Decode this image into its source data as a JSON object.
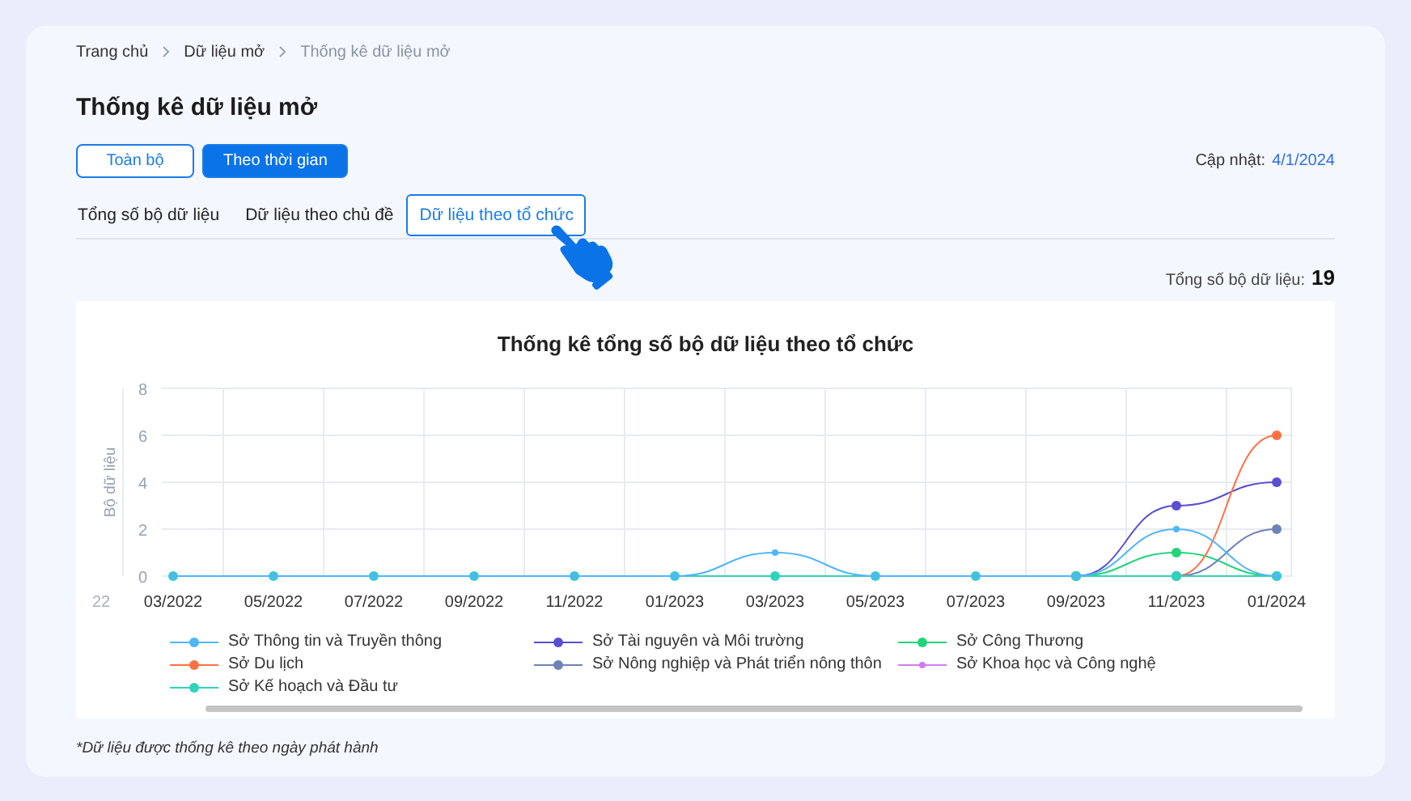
{
  "breadcrumb": [
    {
      "label": "Trang chủ",
      "current": false
    },
    {
      "label": "Dữ liệu mở",
      "current": false
    },
    {
      "label": "Thống kê dữ liệu mở",
      "current": true
    }
  ],
  "title": "Thống kê dữ liệu mở",
  "view_buttons": [
    {
      "label": "Toàn bộ",
      "selected": false
    },
    {
      "label": "Theo thời gian",
      "selected": true
    }
  ],
  "updated": {
    "label": "Cập nhật:",
    "value": "4/1/2024"
  },
  "tabs": [
    {
      "label": "Tổng số bộ dữ liệu",
      "selected": false
    },
    {
      "label": "Dữ liệu theo chủ đề",
      "selected": false
    },
    {
      "label": "Dữ liệu theo tổ chức",
      "selected": true
    }
  ],
  "total": {
    "label": "Tổng số bộ dữ liệu:",
    "value": "19"
  },
  "chart": {
    "clipped_label": "22",
    "chart_data": {
      "type": "line",
      "title": "Thống kê tổng số bộ dữ liệu theo tổ chức",
      "ylabel": "Bộ dữ liệu",
      "grid": true,
      "legend": "bottom",
      "categories": [
        "03/2022",
        "05/2022",
        "07/2022",
        "09/2022",
        "11/2022",
        "01/2023",
        "03/2023",
        "05/2023",
        "07/2023",
        "09/2023",
        "11/2023",
        "01/2024"
      ],
      "ylim": [
        0,
        8
      ],
      "yticks": [
        0,
        2,
        4,
        6,
        8
      ],
      "series": [
        {
          "name": "Sở Thông tin và Truyền thông",
          "color": "#4fb6f7",
          "marker": true,
          "values": [
            0,
            0,
            0,
            0,
            0,
            0,
            1,
            0,
            0,
            0,
            2,
            0
          ]
        },
        {
          "name": "Sở Tài nguyên và Môi trường",
          "color": "#5a4fcf",
          "marker": true,
          "values": [
            null,
            null,
            null,
            null,
            null,
            null,
            null,
            null,
            null,
            0,
            3,
            4
          ]
        },
        {
          "name": "Sở Công Thương",
          "color": "#22d47a",
          "marker": true,
          "values": [
            null,
            null,
            null,
            null,
            null,
            null,
            null,
            null,
            null,
            0,
            1,
            0
          ]
        },
        {
          "name": "Sở Du lịch",
          "color": "#ff7043",
          "marker": true,
          "values": [
            null,
            null,
            null,
            null,
            null,
            null,
            null,
            null,
            null,
            null,
            0,
            6
          ]
        },
        {
          "name": "Sở Nông nghiệp và Phát triển nông thôn",
          "color": "#6f82b8",
          "marker": true,
          "values": [
            null,
            null,
            null,
            null,
            null,
            null,
            null,
            null,
            null,
            null,
            0,
            2
          ]
        },
        {
          "name": "Sở Khoa học và Công nghệ",
          "color": "#d07cf0",
          "values": [
            null,
            null,
            null,
            null,
            null,
            null,
            null,
            null,
            null,
            null,
            null,
            null
          ]
        },
        {
          "name": "Sở Kế hoạch và Đầu tư",
          "color": "#2ed3be",
          "marker": true,
          "values": [
            0,
            0,
            0,
            0,
            0,
            0,
            0,
            0,
            0,
            0,
            0,
            0
          ]
        }
      ]
    }
  },
  "footnote": "*Dữ liệu được thống kê theo ngày phát hành"
}
